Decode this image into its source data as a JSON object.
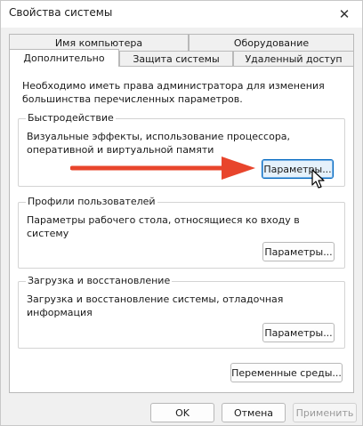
{
  "window": {
    "title": "Свойства системы",
    "close_glyph": "✕"
  },
  "tabs": {
    "back_row": [
      "Имя компьютера",
      "Оборудование"
    ],
    "front_row": [
      "Дополнительно",
      "Защита системы",
      "Удаленный доступ"
    ],
    "active": "Дополнительно"
  },
  "advanced": {
    "admin_note": "Необходимо иметь права администратора для изменения большинства перечисленных параметров.",
    "performance": {
      "title": "Быстродействие",
      "description": "Визуальные эффекты, использование процессора, оперативной и виртуальной памяти",
      "button": "Параметры..."
    },
    "user_profiles": {
      "title": "Профили пользователей",
      "description": "Параметры рабочего стола, относящиеся ко входу в систему",
      "button": "Параметры..."
    },
    "startup_recovery": {
      "title": "Загрузка и восстановление",
      "description": "Загрузка и восстановление системы, отладочная информация",
      "button": "Параметры..."
    },
    "env_button": "Переменные среды..."
  },
  "footer": {
    "ok": "OK",
    "cancel": "Отмена",
    "apply": "Применить"
  },
  "colors": {
    "annotation_arrow": "#e8452c",
    "focus_accent": "#0067c0"
  },
  "icons": {
    "pointer": "mouse-pointer-icon",
    "arrow": "arrow-right-icon",
    "close": "close-icon"
  }
}
